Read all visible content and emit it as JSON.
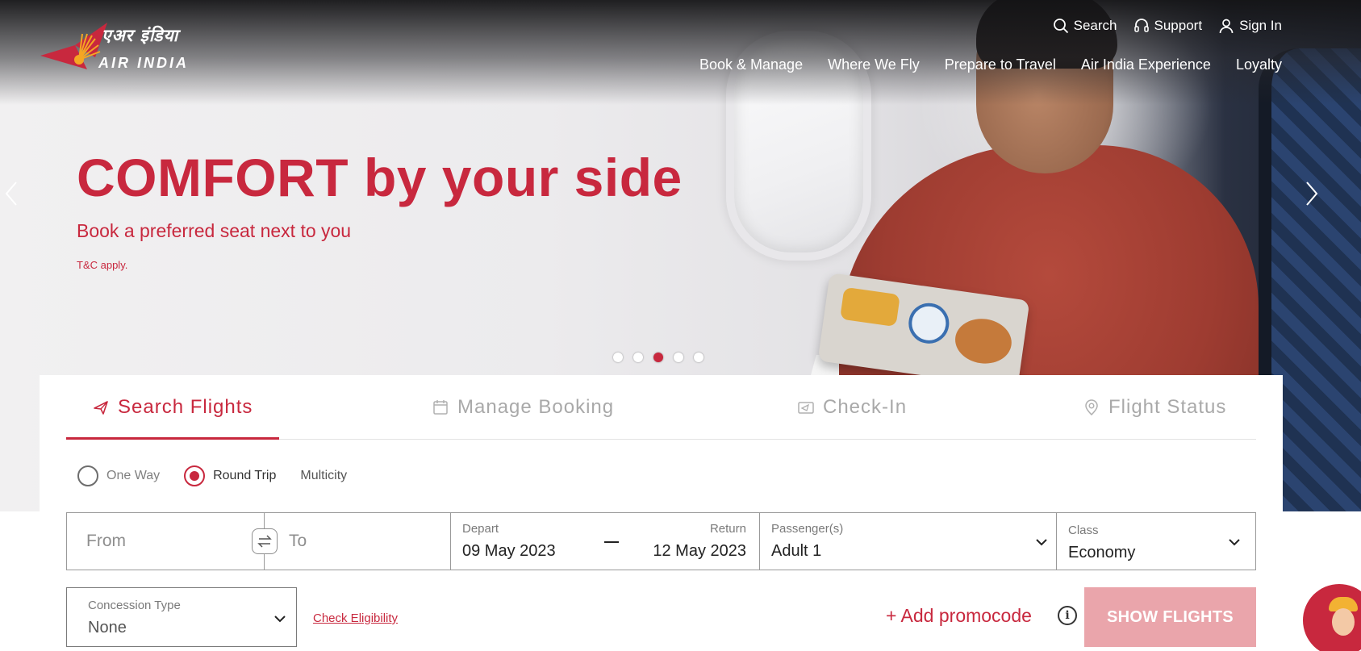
{
  "brand": {
    "hindi": "एअर इंडिया",
    "english": "AIR INDIA",
    "red": "#c8283e"
  },
  "utility_nav": {
    "search": "Search",
    "support": "Support",
    "sign_in": "Sign In"
  },
  "main_nav": [
    "Book & Manage",
    "Where We Fly",
    "Prepare to Travel",
    "Air India Experience",
    "Loyalty"
  ],
  "hero": {
    "headline": "COMFORT by your side",
    "subheadline": "Book a preferred seat next to you",
    "tnc": "T&C apply.",
    "slides_total": 5,
    "active_slide": 3
  },
  "booking": {
    "tabs": [
      "Search  Flights",
      "Manage  Booking",
      "Check-In",
      "Flight  Status"
    ],
    "active_tab": "Search  Flights",
    "trip_types": {
      "one_way": "One Way",
      "round_trip": "Round Trip",
      "multicity": "Multicity"
    },
    "selected_trip": "Round Trip",
    "from_placeholder": "From",
    "to_placeholder": "To",
    "depart": {
      "label": "Depart",
      "value": "09 May 2023"
    },
    "return": {
      "label": "Return",
      "value": "12 May 2023"
    },
    "passengers": {
      "label": "Passenger(s)",
      "value": "Adult 1"
    },
    "class": {
      "label": "Class",
      "value": "Economy"
    },
    "concession": {
      "label": "Concession Type",
      "value": "None"
    },
    "check_eligibility": "Check Eligibility",
    "promo": "+ Add promocode",
    "show_flights": "SHOW FLIGHTS"
  }
}
